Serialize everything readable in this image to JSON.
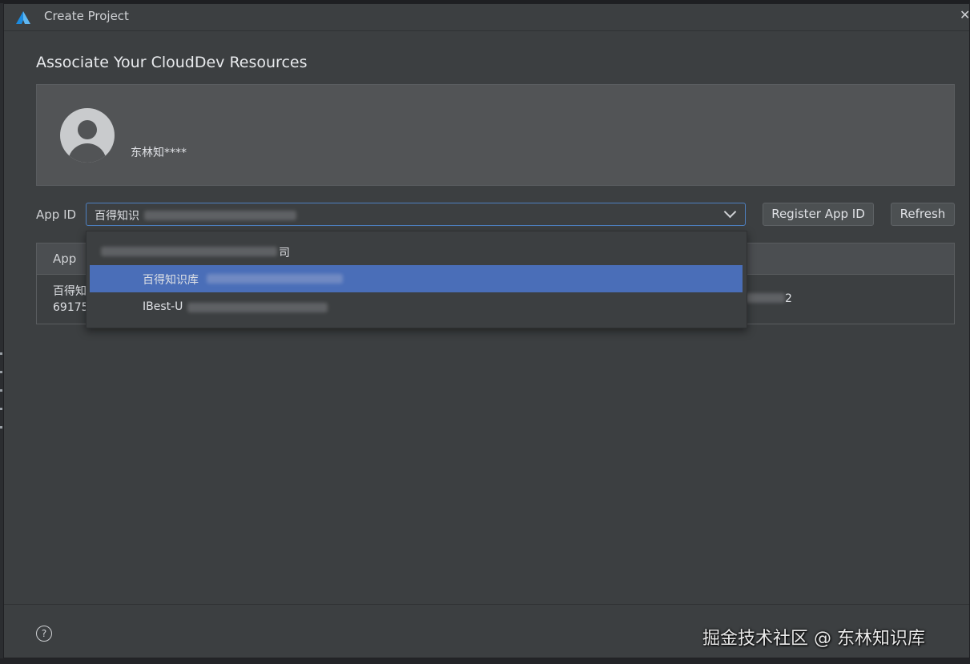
{
  "window": {
    "title": "Create Project"
  },
  "dialog": {
    "heading": "Associate Your CloudDev Resources"
  },
  "account": {
    "user_name": "东林知****"
  },
  "app_id": {
    "label": "App ID",
    "selected_value": "百得知识",
    "register_button": "Register App ID",
    "refresh_button": "Refresh"
  },
  "dropdown": {
    "options": [
      {
        "label": "司",
        "selected": false
      },
      {
        "label": "百得知识库",
        "selected": true
      },
      {
        "label": "IBest-U",
        "selected": false
      }
    ]
  },
  "table": {
    "column_app": "App",
    "row": {
      "name": "百得知",
      "id": "69175",
      "right_value": "2"
    }
  },
  "footer": {
    "help_icon": "?",
    "watermark": "掘金技术社区 @ 东林知识库"
  },
  "colors": {
    "accent": "#4a6eb8",
    "panel": "#3c3f41",
    "card": "#525456"
  }
}
